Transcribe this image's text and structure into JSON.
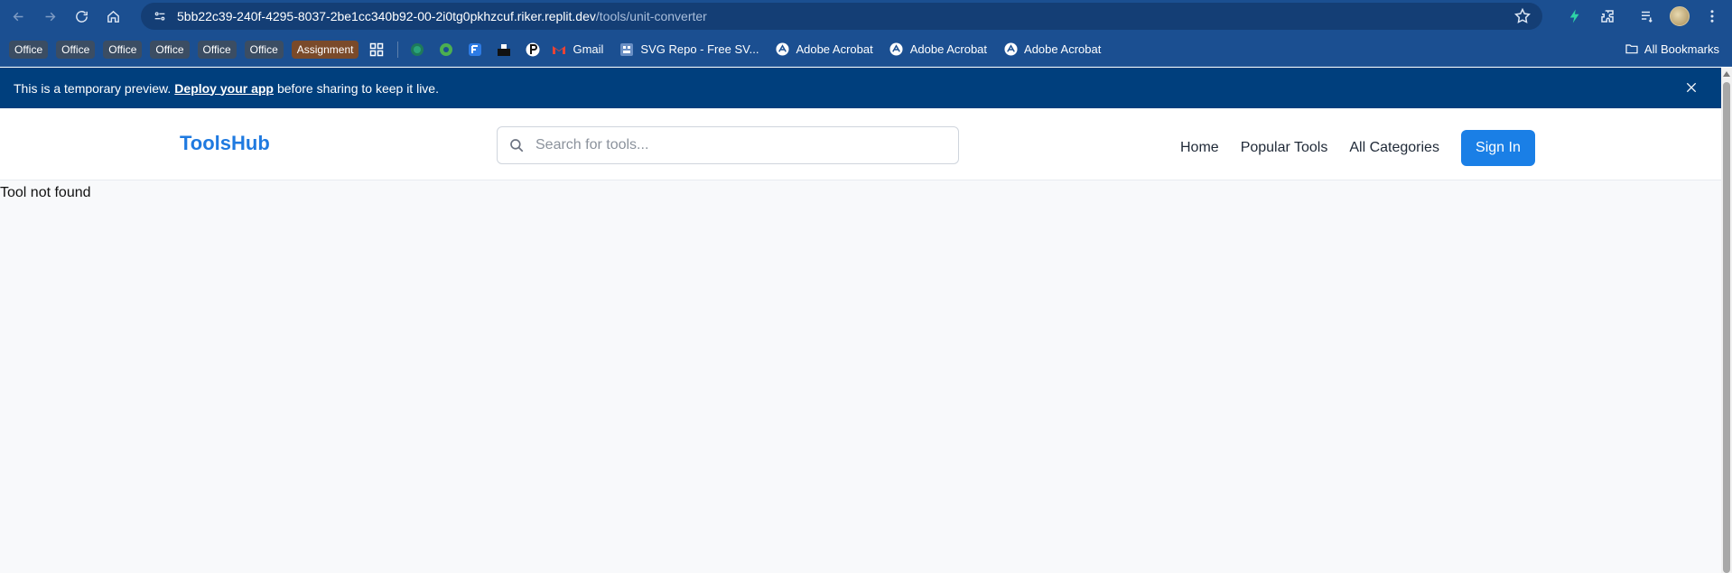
{
  "browser": {
    "url_host": "5bb22c39-240f-4295-8037-2be1cc340b92-00-2i0tg0pkhzcuf.riker.replit.dev",
    "url_path": "/tools/unit-converter"
  },
  "bookmarks": {
    "chips": [
      "Office",
      "Office",
      "Office",
      "Office",
      "Office",
      "Office",
      "Assignment"
    ],
    "items": [
      {
        "label": "Gmail",
        "icon": "gmail-icon"
      },
      {
        "label": "SVG Repo - Free SV...",
        "icon": "svgrepo-icon"
      },
      {
        "label": "Adobe Acrobat",
        "icon": "acrobat-icon"
      },
      {
        "label": "Adobe Acrobat",
        "icon": "acrobat-icon"
      },
      {
        "label": "Adobe Acrobat",
        "icon": "acrobat-icon"
      }
    ],
    "all_label": "All Bookmarks"
  },
  "banner": {
    "text_before": "This is a temporary preview.",
    "link": "Deploy your app",
    "text_after": "before sharing to keep it live."
  },
  "header": {
    "logo": "ToolsHub",
    "search_placeholder": "Search for tools...",
    "nav": [
      "Home",
      "Popular Tools",
      "All Categories"
    ],
    "signin": "Sign In"
  },
  "main": {
    "message": "Tool not found"
  },
  "colors": {
    "chrome": "#1b4f91",
    "banner": "#003f7d",
    "accent": "#1a7fe6"
  }
}
